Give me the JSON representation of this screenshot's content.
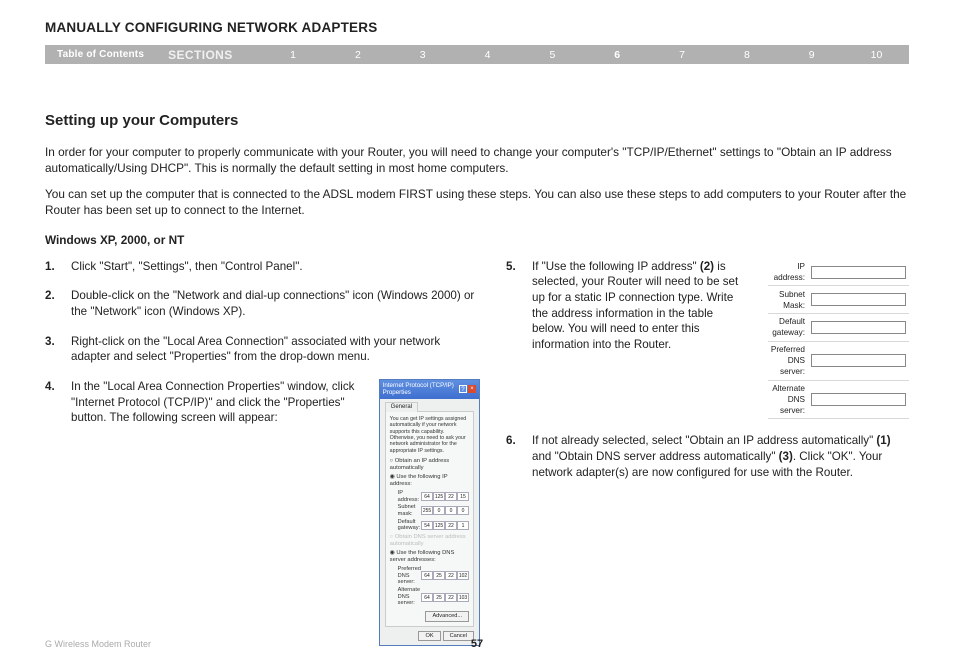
{
  "header": {
    "title": "MANUALLY CONFIGURING NETWORK ADAPTERS"
  },
  "nav": {
    "toc": "Table of Contents",
    "sections_label": "SECTIONS",
    "items": [
      "1",
      "2",
      "3",
      "4",
      "5",
      "6",
      "7",
      "8",
      "9",
      "10"
    ],
    "current": "6"
  },
  "section": {
    "title": "Setting up your Computers",
    "intro1": "In order for your computer to properly communicate with your Router, you will need to change your computer's \"TCP/IP/Ethernet\" settings to \"Obtain an IP address automatically/Using DHCP\". This is normally the default setting in most home computers.",
    "intro2": "You can set up the computer that is connected to the ADSL modem FIRST using these steps. You can also use these steps to add computers to your Router after the Router has been set up to connect to the Internet.",
    "subhead": "Windows XP, 2000, or NT"
  },
  "steps_left": [
    {
      "n": "1.",
      "t": "Click \"Start\", \"Settings\", then \"Control Panel\"."
    },
    {
      "n": "2.",
      "t": "Double-click on the \"Network and dial-up connections\" icon (Windows 2000) or the \"Network\" icon (Windows XP)."
    },
    {
      "n": "3.",
      "t": "Right-click on the \"Local Area Connection\" associated with your network adapter and select \"Properties\" from the drop-down menu."
    },
    {
      "n": "4.",
      "t": "In the \"Local Area Connection Properties\" window, click \"Internet Protocol (TCP/IP)\" and click the \"Properties\" button. The following screen will appear:"
    }
  ],
  "steps_right": [
    {
      "n": "5.",
      "t": "If \"Use the following IP address\" (2) is selected, your Router will need to be set up for a static IP connection type. Write the address information in the table below. You will need to enter this information into the Router."
    },
    {
      "n": "6.",
      "t": "If not already selected, select \"Obtain an IP address automatically\" (1) and \"Obtain DNS server address automatically\" (3). Click \"OK\". Your network adapter(s) are now configured for use with the Router."
    }
  ],
  "bold_markers": {
    "m2": "(2)",
    "m1": "(1)",
    "m3": "(3)"
  },
  "tcpip": {
    "title": "Internet Protocol (TCP/IP) Properties",
    "help": "?",
    "close": "×",
    "tab": "General",
    "desc": "You can get IP settings assigned automatically if your network supports this capability. Otherwise, you need to ask your network administrator for the appropriate IP settings.",
    "radio_auto_ip": "Obtain an IP address automatically",
    "radio_use_ip": "Use the following IP address:",
    "ip_label": "IP address:",
    "subnet_label": "Subnet mask:",
    "gateway_label": "Default gateway:",
    "radio_auto_dns": "Obtain DNS server address automatically",
    "radio_use_dns": "Use the following DNS server addresses:",
    "pref_dns_label": "Preferred DNS server:",
    "alt_dns_label": "Alternate DNS server:",
    "ip_vals": [
      "64",
      "125",
      "22",
      "15"
    ],
    "subnet_vals": [
      "255",
      "0",
      "0",
      "0"
    ],
    "gateway_vals": [
      "54",
      "125",
      "22",
      "1"
    ],
    "pref_dns_vals": [
      "64",
      "25",
      "22",
      "102"
    ],
    "alt_dns_vals": [
      "64",
      "25",
      "22",
      "103"
    ],
    "advanced": "Advanced...",
    "ok": "OK",
    "cancel": "Cancel"
  },
  "ip_table": {
    "rows": [
      "IP address:",
      "Subnet Mask:",
      "Default gateway:",
      "Preferred DNS server:",
      "Alternate DNS server:"
    ]
  },
  "footer": {
    "product": "G Wireless Modem Router",
    "page": "57"
  }
}
